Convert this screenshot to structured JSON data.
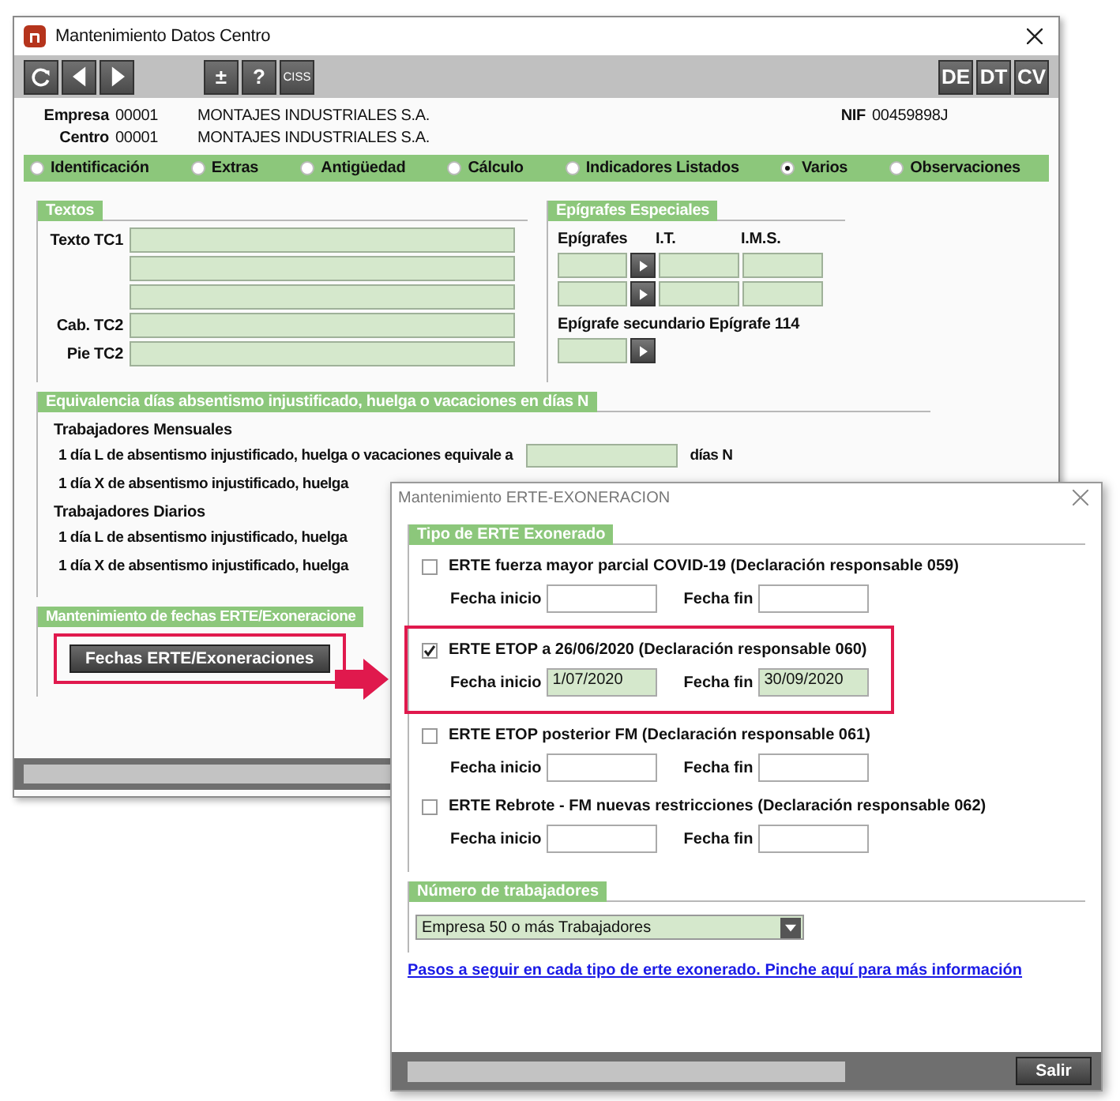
{
  "main_window": {
    "title": "Mantenimiento Datos Centro",
    "toolbar_buttons": [
      "±",
      "?",
      "CISS"
    ],
    "toolbar_right_buttons": [
      "DE",
      "DT",
      "CV"
    ],
    "info": {
      "empresa_label": "Empresa",
      "empresa_code": "00001",
      "empresa_name": "MONTAJES INDUSTRIALES S.A.",
      "centro_label": "Centro",
      "centro_code": "00001",
      "centro_name": "MONTAJES INDUSTRIALES S.A.",
      "nif_label": "NIF",
      "nif_value": "00459898J"
    },
    "tabs": [
      {
        "label": "Identificación",
        "selected": false
      },
      {
        "label": "Extras",
        "selected": false
      },
      {
        "label": "Antigüedad",
        "selected": false
      },
      {
        "label": "Cálculo",
        "selected": false
      },
      {
        "label": "Indicadores Listados",
        "selected": false
      },
      {
        "label": "Varios",
        "selected": true
      },
      {
        "label": "Observaciones",
        "selected": false
      }
    ],
    "textos": {
      "title": "Textos",
      "texto_tc1_label": "Texto TC1",
      "cab_tc2_label": "Cab. TC2",
      "pie_tc2_label": "Pie TC2"
    },
    "epigrafes": {
      "title": "Epígrafes Especiales",
      "column_labels": [
        "Epígrafes",
        "I.T.",
        "I.M.S."
      ],
      "secondary_label": "Epígrafe secundario Epígrafe 114"
    },
    "equivalencia": {
      "title": "Equivalencia días absentismo injustificado, huelga o vacaciones en días N",
      "groups": [
        {
          "heading": "Trabajadores Mensuales",
          "lines": [
            {
              "text": "1 día L de absentismo injustificado, huelga o vacaciones equivale a",
              "unit": "días N"
            },
            {
              "text": "1 día X de absentismo injustificado, huelga"
            }
          ]
        },
        {
          "heading": "Trabajadores Diarios",
          "lines": [
            {
              "text": "1 día L de absentismo injustificado, huelga"
            },
            {
              "text": "1 día X de absentismo injustificado, huelga"
            }
          ]
        }
      ]
    },
    "erte": {
      "title": "Mantenimiento de fechas ERTE/Exoneracione",
      "button": "Fechas ERTE/Exoneraciones",
      "highlighted": true
    }
  },
  "dialog": {
    "title": "Mantenimiento ERTE-EXONERACION",
    "group_title": "Tipo de ERTE Exonerado",
    "options": [
      {
        "label": "ERTE fuerza mayor parcial COVID-19 (Declaración responsable 059)",
        "checked": false,
        "highlighted": false,
        "start_label": "Fecha inicio",
        "end_label": "Fecha fin"
      },
      {
        "label": "ERTE ETOP a 26/06/2020 (Declaración responsable 060)",
        "checked": true,
        "highlighted": true,
        "start_label": "Fecha inicio",
        "start_value": "1/07/2020",
        "end_label": "Fecha fin",
        "end_value": "30/09/2020"
      },
      {
        "label": "ERTE ETOP posterior FM (Declaración responsable 061)",
        "checked": false,
        "highlighted": false,
        "start_label": "Fecha inicio",
        "end_label": "Fecha fin"
      },
      {
        "label": "ERTE Rebrote - FM nuevas restricciones (Declaración responsable 062)",
        "checked": false,
        "highlighted": false,
        "start_label": "Fecha inicio",
        "end_label": "Fecha fin"
      }
    ],
    "workers": {
      "title": "Número de trabajadores",
      "value": "Empresa 50 o más Trabajadores"
    },
    "link": "Pasos a seguir en cada tipo de erte exonerado. Pinche aquí para más información",
    "button": "Salir"
  }
}
